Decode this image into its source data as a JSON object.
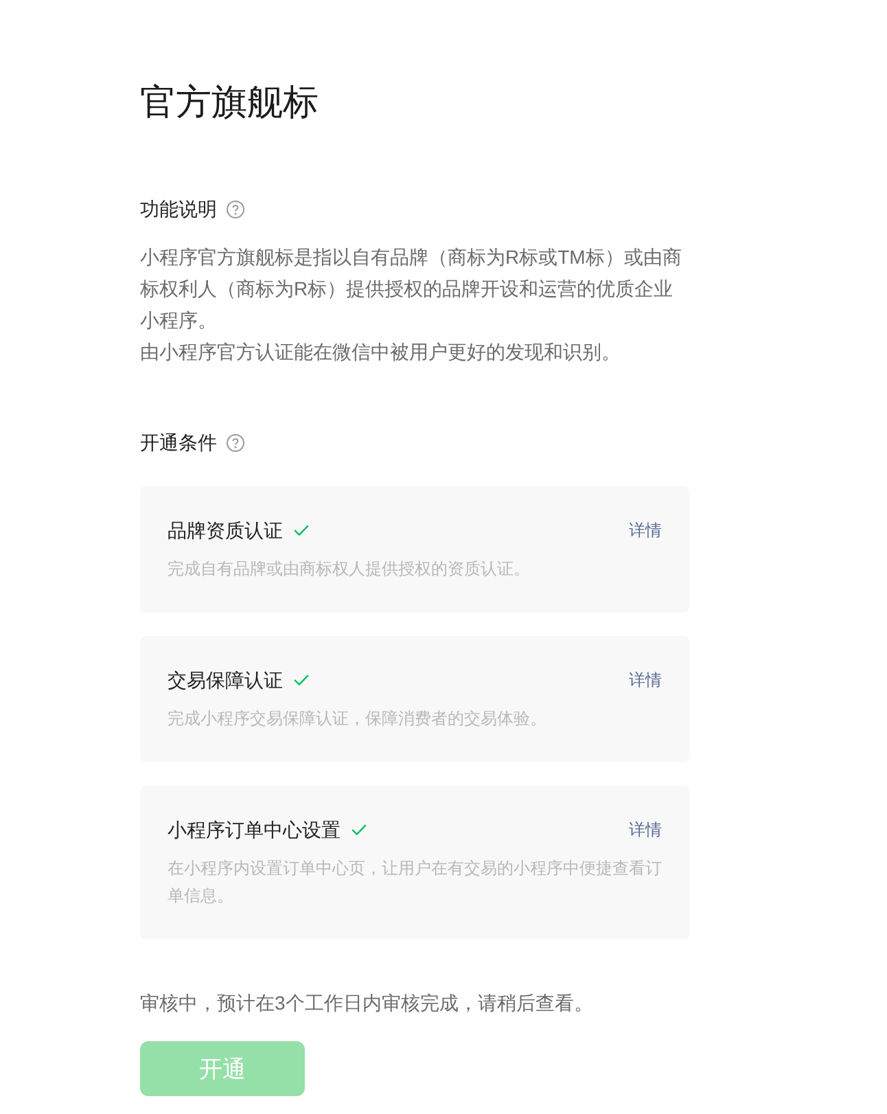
{
  "page": {
    "title": "官方旗舰标"
  },
  "feature_description": {
    "heading": "功能说明",
    "paragraphs": [
      "小程序官方旗舰标是指以自有品牌（商标为R标或TM标）或由商标权利人（商标为R标）提供授权的品牌开设和运营的优质企业小程序。",
      "由小程序官方认证能在微信中被用户更好的发现和识别。"
    ]
  },
  "conditions": {
    "heading": "开通条件",
    "items": [
      {
        "title": "品牌资质认证",
        "done": true,
        "link": "详情",
        "description": "完成自有品牌或由商标权人提供授权的资质认证。"
      },
      {
        "title": "交易保障认证",
        "done": true,
        "link": "详情",
        "description": "完成小程序交易保障认证，保障消费者的交易体验。"
      },
      {
        "title": "小程序订单中心设置",
        "done": true,
        "link": "详情",
        "description": "在小程序内设置订单中心页，让用户在有交易的小程序中便捷查看订单信息。"
      }
    ]
  },
  "status_text": "审核中，预计在3个工作日内审核完成，请稍后查看。",
  "open_button": {
    "label": "开通",
    "disabled": true
  }
}
